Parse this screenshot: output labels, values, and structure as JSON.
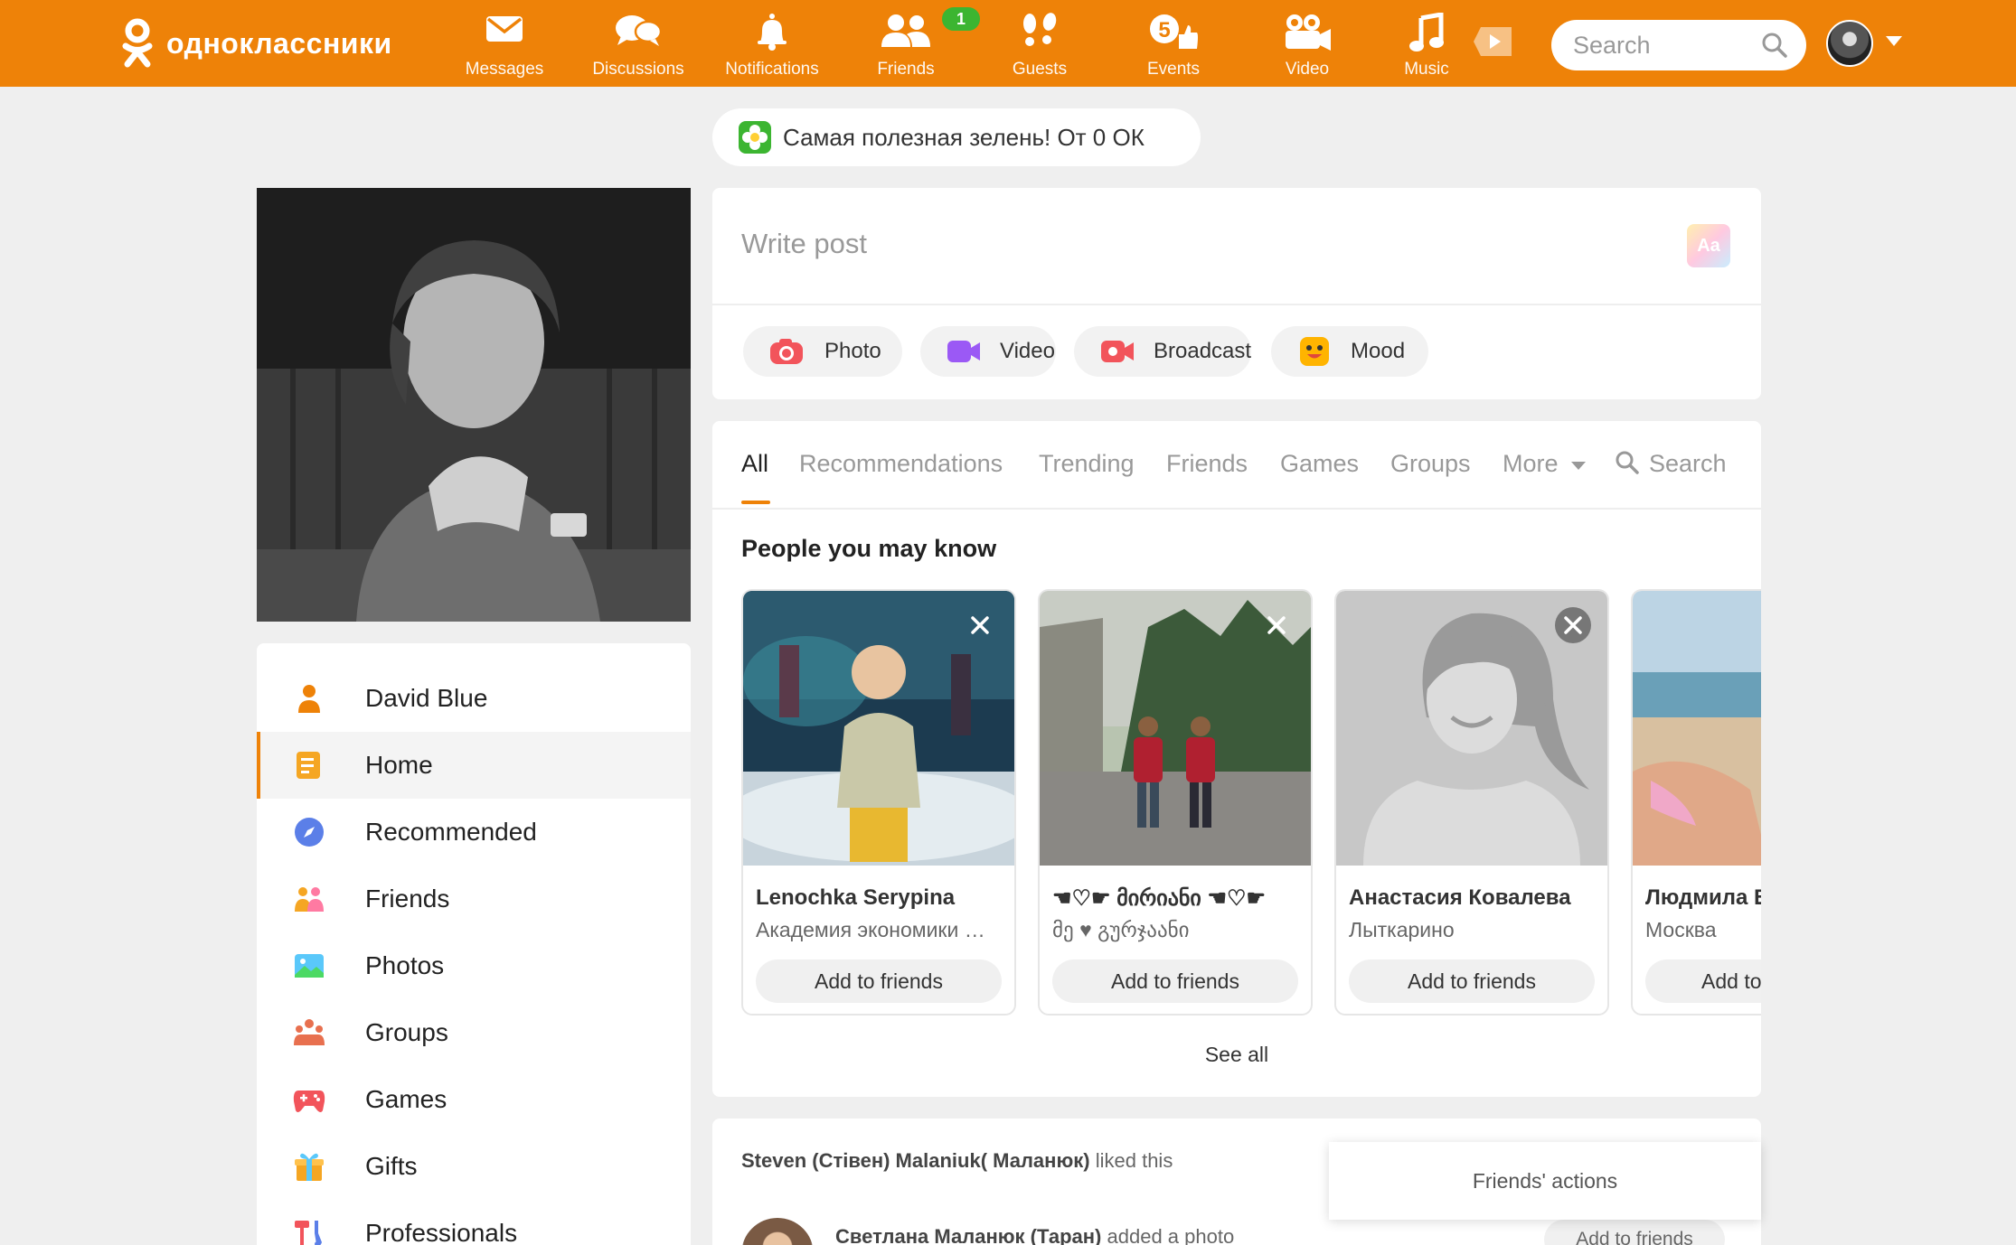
{
  "header": {
    "logo_text": "одноклассники",
    "nav": [
      {
        "label": "Messages",
        "icon": "envelope-icon"
      },
      {
        "label": "Discussions",
        "icon": "speech-bubbles-icon"
      },
      {
        "label": "Notifications",
        "icon": "bell-icon"
      },
      {
        "label": "Friends",
        "icon": "friends-icon",
        "badge": "1"
      },
      {
        "label": "Guests",
        "icon": "footprints-icon"
      },
      {
        "label": "Events",
        "icon": "events-icon"
      },
      {
        "label": "Video",
        "icon": "video-camera-icon"
      },
      {
        "label": "Music",
        "icon": "music-note-icon"
      }
    ],
    "search_placeholder": "Search",
    "colors": {
      "brand": "#ee8208",
      "badge": "#3cb531"
    }
  },
  "promo": {
    "text": "Самая полезная зелень! От 0 ОК"
  },
  "left_menu": {
    "items": [
      {
        "label": "David Blue",
        "icon": "user-icon"
      },
      {
        "label": "Home",
        "icon": "home-feed-icon",
        "active": true
      },
      {
        "label": "Recommended",
        "icon": "compass-icon"
      },
      {
        "label": "Friends",
        "icon": "friends-icon"
      },
      {
        "label": "Photos",
        "icon": "photo-icon"
      },
      {
        "label": "Groups",
        "icon": "groups-icon"
      },
      {
        "label": "Games",
        "icon": "gamepad-icon"
      },
      {
        "label": "Gifts",
        "icon": "gift-icon"
      },
      {
        "label": "Professionals",
        "icon": "tools-icon"
      }
    ]
  },
  "composer": {
    "placeholder": "Write post",
    "format_label": "Aa",
    "actions": [
      {
        "label": "Photo",
        "icon": "camera-icon"
      },
      {
        "label": "Video",
        "icon": "video-icon"
      },
      {
        "label": "Broadcast",
        "icon": "broadcast-icon"
      },
      {
        "label": "Mood",
        "icon": "smiley-icon"
      }
    ]
  },
  "feed": {
    "tabs": [
      "All",
      "Recommendations",
      "Trending",
      "Friends",
      "Games",
      "Groups",
      "More",
      "Search"
    ],
    "active_tab": "All",
    "pymk_title": "People you may know",
    "people": [
      {
        "name": "Lenochka Serypina",
        "sub": "Академия экономики …",
        "button": "Add to friends"
      },
      {
        "name": "☚♡☛ მირიანი ☚♡☛",
        "sub": "მე ♥ გურჯაანი",
        "button": "Add to friends"
      },
      {
        "name": "Анастасия Ковалева",
        "sub": "Лыткарино",
        "button": "Add to friends"
      },
      {
        "name": "Людмила Б",
        "sub": "Москва",
        "button": "Add to"
      }
    ],
    "see_all": "See all"
  },
  "activity": {
    "actor": "Steven (Стівен) Malaniuk( Маланюк)",
    "action": "liked this",
    "poster": "Светлана Маланюк (Таран)",
    "poster_action": "added a photo",
    "add_label": "Add to friends",
    "friends_actions": "Friends' actions"
  }
}
